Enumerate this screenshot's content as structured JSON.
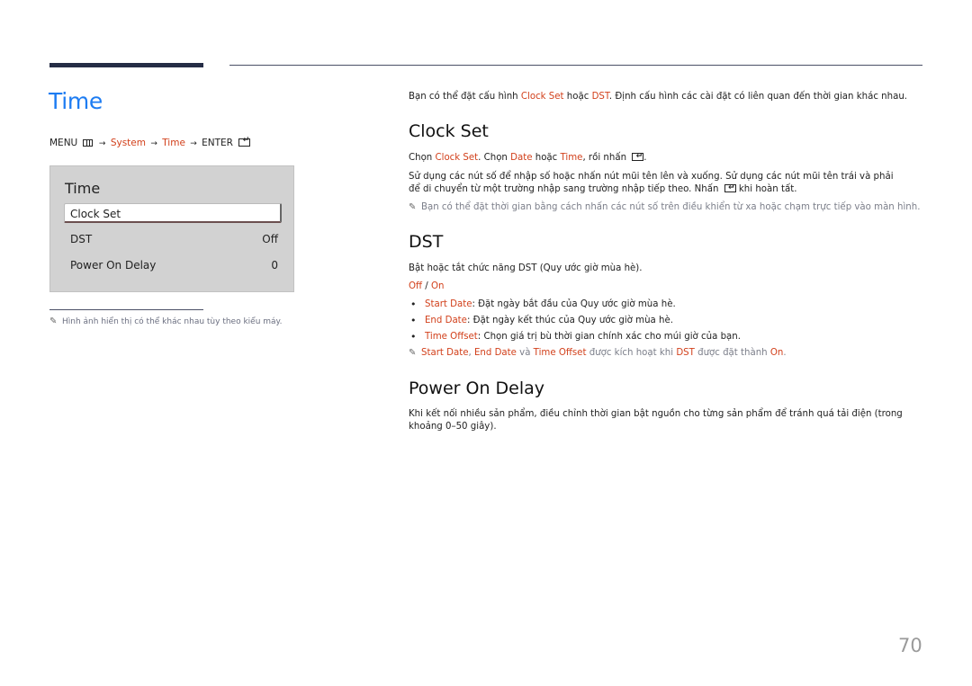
{
  "page": {
    "title": "Time",
    "page_number": "70"
  },
  "menu_path": {
    "menu": "MENU",
    "menu_icon": "menu-icon",
    "items": [
      "System",
      "Time"
    ],
    "enter": "ENTER",
    "enter_icon": "enter-icon",
    "arrow": "→"
  },
  "osd_panel": {
    "title": "Time",
    "items": [
      {
        "label": "Clock Set",
        "value": "",
        "selected": true
      },
      {
        "label": "DST",
        "value": "Off",
        "selected": false
      },
      {
        "label": "Power On Delay",
        "value": "0",
        "selected": false
      }
    ]
  },
  "footnote": {
    "icon": "pencil-icon",
    "text": "Hình ảnh hiển thị có thể khác nhau tùy theo kiểu máy."
  },
  "intro": {
    "t1": "Bạn có thể đặt cấu hình ",
    "k1": "Clock Set",
    "t2": " hoặc ",
    "k2": "DST",
    "t3": ". Định cấu hình các cài đặt có liên quan đến thời gian khác nhau."
  },
  "clock_set": {
    "heading": "Clock Set",
    "p1": {
      "t1": "Chọn ",
      "k1": "Clock Set",
      "t2": ". Chọn ",
      "k2": "Date",
      "t3": " hoặc ",
      "k3": "Time",
      "t4": ", rồi nhấn ",
      "t5": "."
    },
    "p2": {
      "t1": "Sử dụng các nút số để nhập số hoặc nhấn nút mũi tên lên và xuống. Sử dụng các nút mũi tên trái và phải để di chuyển từ một trường nhập sang trường nhập tiếp theo. Nhấn ",
      "t2": " khi hoàn tất."
    },
    "note": "Bạn có thể đặt thời gian bằng cách nhấn các nút số trên điều khiển từ xa hoặc chạm trực tiếp vào màn hình."
  },
  "dst": {
    "heading": "DST",
    "desc": "Bật hoặc tắt chức năng DST (Quy ước giờ mùa hè).",
    "options": {
      "off": "Off",
      "sep": " / ",
      "on": "On"
    },
    "bullets": [
      {
        "key": "Start Date",
        "text": ": Đặt ngày bắt đầu của Quy ước giờ mùa hè."
      },
      {
        "key": "End Date",
        "text": ": Đặt ngày kết thúc của Quy ước giờ mùa hè."
      },
      {
        "key": "Time Offset",
        "text": ": Chọn giá trị bù thời gian chính xác cho múi giờ của bạn."
      }
    ],
    "note": {
      "k1": "Start Date",
      "t1": ", ",
      "k2": "End Date",
      "t2": " và ",
      "k3": "Time Offset",
      "t3": " được kích hoạt khi ",
      "k4": "DST",
      "t4": " được đặt thành ",
      "k5": "On",
      "t5": "."
    }
  },
  "power_on_delay": {
    "heading": "Power On Delay",
    "desc": "Khi kết nối nhiều sản phẩm, điều chỉnh thời gian bật nguồn cho từng sản phẩm để tránh quá tải điện (trong khoảng 0–50 giây)."
  },
  "colors": {
    "title_blue": "#1d7cf2",
    "highlight_red": "#d2401b",
    "header_bar": "#252d45",
    "panel_bg": "#d2d2d2"
  }
}
